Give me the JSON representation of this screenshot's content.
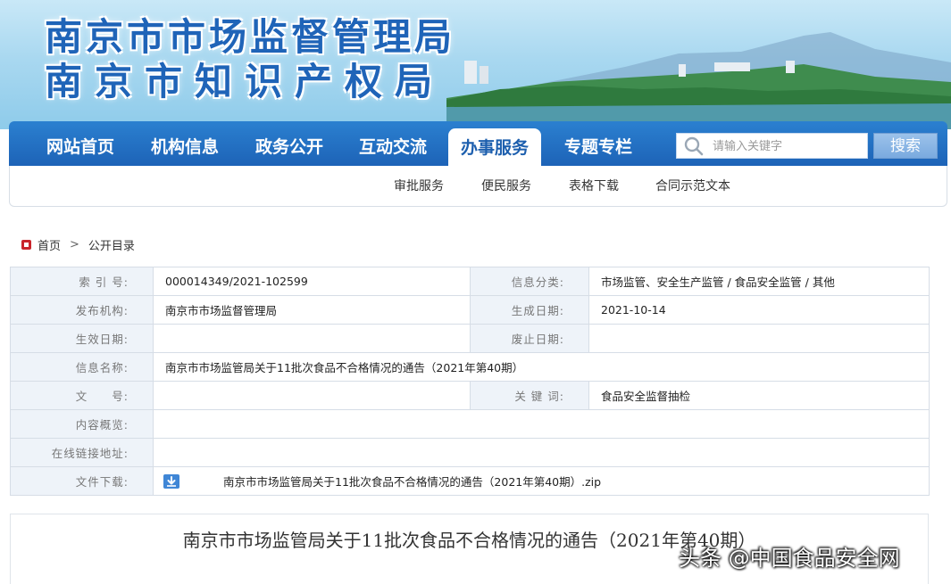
{
  "banner": {
    "title_line1": "南京市市场监督管理局",
    "title_line2": "南京市知识产权局"
  },
  "nav": {
    "items": [
      {
        "label": "网站首页"
      },
      {
        "label": "机构信息"
      },
      {
        "label": "政务公开"
      },
      {
        "label": "互动交流"
      },
      {
        "label": "办事服务",
        "active": true
      },
      {
        "label": "专题专栏"
      }
    ],
    "search_placeholder": "请输入关键字",
    "search_button": "搜索",
    "sub_items": [
      "审批服务",
      "便民服务",
      "表格下载",
      "合同示范文本"
    ]
  },
  "breadcrumb": {
    "home": "首页",
    "separator": ">",
    "current": "公开目录"
  },
  "info": {
    "index_label": "索 引 号:",
    "index_value": "000014349/2021-102599",
    "category_label": "信息分类:",
    "category_value": "市场监管、安全生产监管 / 食品安全监管 / 其他",
    "publisher_label": "发布机构:",
    "publisher_value": "南京市市场监督管理局",
    "created_label": "生成日期:",
    "created_value": "2021-10-14",
    "effective_label": "生效日期:",
    "effective_value": "",
    "abolished_label": "废止日期:",
    "abolished_value": "",
    "name_label": "信息名称:",
    "name_value": "南京市市场监管局关于11批次食品不合格情况的通告（2021年第40期）",
    "doc_no_label": "文　　号:",
    "doc_no_value": "",
    "keywords_label": "关 键 词:",
    "keywords_value": "食品安全监督抽检",
    "summary_label": "内容概览:",
    "summary_value": "",
    "link_label": "在线链接地址:",
    "link_value": "",
    "download_label": "文件下载:",
    "download_file": "南京市市场监管局关于11批次食品不合格情况的通告（2021年第40期）.zip"
  },
  "article": {
    "title": "南京市市场监管局关于11批次食品不合格情况的通告（2021年第40期）"
  },
  "watermark": "头条 @中国食品安全网",
  "colors": {
    "nav_blue": "#1d63b7",
    "label_bg": "#eef3f9",
    "home_icon_red": "#c9242b"
  }
}
